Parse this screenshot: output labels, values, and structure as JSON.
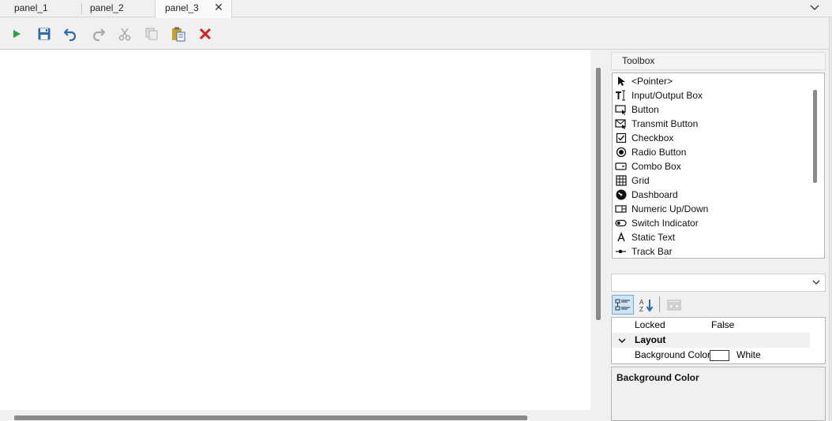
{
  "tabs": [
    {
      "label": "panel_1"
    },
    {
      "label": "panel_2"
    },
    {
      "label": "panel_3",
      "active": true,
      "close_glyph": "✕"
    }
  ],
  "toolbar": {
    "buttons": [
      {
        "name": "run-button",
        "icon": "play-icon",
        "enabled": true
      },
      {
        "name": "save-button",
        "icon": "save-icon",
        "enabled": true
      },
      {
        "name": "undo-button",
        "icon": "undo-icon",
        "enabled": true
      },
      {
        "name": "redo-button",
        "icon": "redo-icon",
        "enabled": false
      },
      {
        "name": "cut-button",
        "icon": "cut-icon",
        "enabled": false
      },
      {
        "name": "copy-button",
        "icon": "copy-icon",
        "enabled": false
      },
      {
        "name": "paste-button",
        "icon": "paste-icon",
        "enabled": true
      },
      {
        "name": "delete-button",
        "icon": "delete-icon",
        "enabled": true
      }
    ]
  },
  "toolbox": {
    "title": "Toolbox",
    "items": [
      {
        "label": "<Pointer>",
        "icon": "pointer-icon"
      },
      {
        "label": "Input/Output Box",
        "icon": "text-input-icon"
      },
      {
        "label": "Button",
        "icon": "button-icon"
      },
      {
        "label": "Transmit Button",
        "icon": "transmit-button-icon"
      },
      {
        "label": "Checkbox",
        "icon": "checkbox-icon"
      },
      {
        "label": "Radio Button",
        "icon": "radio-button-icon"
      },
      {
        "label": "Combo Box",
        "icon": "combo-box-icon"
      },
      {
        "label": "Grid",
        "icon": "grid-icon"
      },
      {
        "label": "Dashboard",
        "icon": "dashboard-icon"
      },
      {
        "label": "Numeric Up/Down",
        "icon": "numeric-updown-icon"
      },
      {
        "label": "Switch Indicator",
        "icon": "switch-indicator-icon"
      },
      {
        "label": "Static Text",
        "icon": "static-text-icon"
      },
      {
        "label": "Track Bar",
        "icon": "track-bar-icon"
      }
    ]
  },
  "properties": {
    "object_selector": "",
    "rows": [
      {
        "type": "prop",
        "name": "Locked",
        "value": "False"
      },
      {
        "type": "category",
        "name": "Layout"
      },
      {
        "type": "prop",
        "name": "Background Color",
        "value": "White",
        "swatch": "#ffffff"
      }
    ],
    "description_title": "Background Color"
  },
  "colors": {
    "accent": "#cce4f7",
    "run_green": "#2e9e3e",
    "delete_red": "#d42020",
    "save_blue": "#2b6cb0"
  }
}
